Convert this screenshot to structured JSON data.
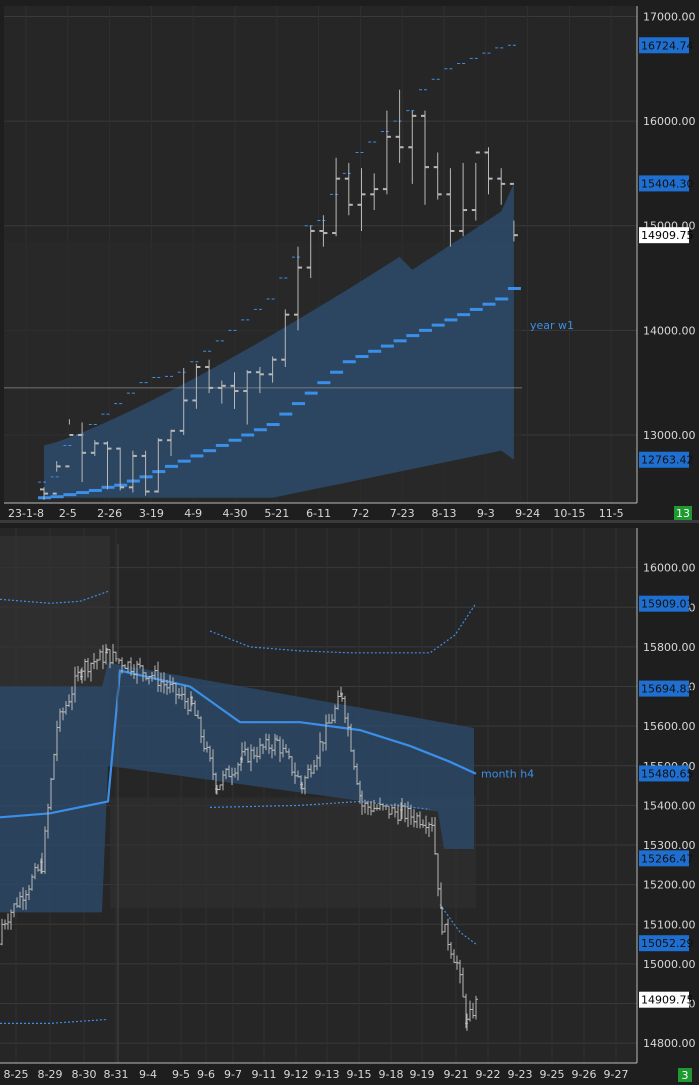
{
  "colors": {
    "background": "#262626",
    "grid": "#3a3a3a",
    "axis_text": "#d8d8d8",
    "candle": "#b8b8b8",
    "band": "#2d4a6a",
    "accent_blue": "#3b8fe8",
    "label_bg": "#1f6fd0",
    "counter_green": "#1f9a30",
    "price_tag_bg": "#ffffff"
  },
  "chart_data": [
    {
      "type": "candlestick",
      "title": "",
      "ylim": [
        12350,
        17100
      ],
      "y_ticks": [
        "17000.00",
        "16000.00",
        "15000.00",
        "14000.00",
        "13000.00"
      ],
      "x_tick_labels": [
        "23-1-8",
        "2-5",
        "2-26",
        "3-19",
        "4-9",
        "4-30",
        "5-21",
        "6-11",
        "7-2",
        "7-23",
        "8-13",
        "9-3",
        "9-24",
        "10-15",
        "11-5"
      ],
      "price_tags": [
        {
          "text": "16724.74",
          "value": 16724.74,
          "style": "blue"
        },
        {
          "text": "15404.30",
          "value": 15404.3,
          "style": "blue"
        },
        {
          "text": "14909.75",
          "value": 14909.75,
          "style": "white"
        },
        {
          "text": "12763.42",
          "value": 12763.42,
          "style": "blue"
        }
      ],
      "series_label": "year w1",
      "corner_badge": "13",
      "candles": [
        [
          12480,
          12500,
          12380,
          12440
        ],
        [
          12440,
          12750,
          12650,
          12700
        ],
        [
          12700,
          13150,
          13100,
          13000
        ],
        [
          13000,
          13120,
          12550,
          12830
        ],
        [
          12830,
          12950,
          12800,
          12920
        ],
        [
          12920,
          12940,
          12480,
          12870
        ],
        [
          12870,
          12880,
          12470,
          12500
        ],
        [
          12500,
          12850,
          12450,
          12800
        ],
        [
          12800,
          12850,
          12420,
          12460
        ],
        [
          12460,
          12970,
          12450,
          12950
        ],
        [
          12950,
          13050,
          12800,
          13040
        ],
        [
          13040,
          13640,
          13000,
          13330
        ],
        [
          13330,
          13680,
          13250,
          13650
        ],
        [
          13650,
          13720,
          13400,
          13450
        ],
        [
          13450,
          13520,
          13300,
          13470
        ],
        [
          13470,
          13600,
          13250,
          13420
        ],
        [
          13420,
          13620,
          13100,
          13600
        ],
        [
          13600,
          13650,
          13400,
          13580
        ],
        [
          13580,
          13750,
          13500,
          13720
        ],
        [
          13720,
          14200,
          13650,
          14150
        ],
        [
          14150,
          14800,
          14000,
          14600
        ],
        [
          14600,
          15000,
          14500,
          14950
        ],
        [
          14950,
          15100,
          14800,
          14930
        ],
        [
          14930,
          15650,
          14900,
          15450
        ],
        [
          15450,
          15600,
          15100,
          15200
        ],
        [
          15200,
          15550,
          14950,
          15300
        ],
        [
          15300,
          15500,
          15150,
          15350
        ],
        [
          15350,
          16100,
          15300,
          15850
        ],
        [
          15850,
          16300,
          15600,
          15750
        ],
        [
          15750,
          16100,
          15400,
          16050
        ],
        [
          16050,
          16100,
          15200,
          15560
        ],
        [
          15560,
          15700,
          15250,
          15300
        ],
        [
          15300,
          15550,
          14800,
          14950
        ],
        [
          14950,
          15600,
          14900,
          15150
        ],
        [
          15150,
          15600,
          15050,
          15700
        ],
        [
          15700,
          15750,
          15300,
          15450
        ],
        [
          15450,
          15550,
          15200,
          15400
        ],
        [
          15400,
          15050,
          14850,
          14909.75
        ]
      ],
      "upper_dashes": [
        12550,
        12600,
        12900,
        13000,
        13100,
        13200,
        13300,
        13400,
        13500,
        13550,
        13560,
        13600,
        13700,
        13800,
        13900,
        14000,
        14100,
        14200,
        14300,
        14500,
        14700,
        15000,
        15050,
        15300,
        15500,
        15700,
        15800,
        15900,
        16000,
        16100,
        16300,
        16400,
        16500,
        16550,
        16600,
        16650,
        16700,
        16724.74
      ],
      "year_line": [
        12400,
        12410,
        12430,
        12450,
        12470,
        12500,
        12520,
        12560,
        12600,
        12650,
        12700,
        12750,
        12800,
        12850,
        12900,
        12950,
        13000,
        13050,
        13100,
        13200,
        13300,
        13400,
        13500,
        13600,
        13700,
        13750,
        13800,
        13850,
        13900,
        13950,
        14000,
        14050,
        14100,
        14150,
        14200,
        14250,
        14300,
        14400
      ]
    },
    {
      "type": "candlestick",
      "title": "",
      "ylim": [
        14750,
        16100
      ],
      "y_ticks": [
        "16000.00",
        "15900.00",
        "15800.00",
        "15700.00",
        "15600.00",
        "15500.00",
        "15400.00",
        "15300.00",
        "15200.00",
        "15100.00",
        "15000.00",
        "14900.00",
        "14800.00"
      ],
      "x_tick_labels": [
        "8-25",
        "8-29",
        "8-30",
        "8-31",
        "9-4",
        "9-5",
        "9-6",
        "9-7",
        "9-11",
        "9-12",
        "9-13",
        "9-15",
        "9-18",
        "9-19",
        "9-21",
        "9-22",
        "9-23",
        "9-25",
        "9-26",
        "9-27"
      ],
      "price_tags": [
        {
          "text": "15909.01",
          "value": 15909.01,
          "style": "blue"
        },
        {
          "text": "15694.83",
          "value": 15694.83,
          "style": "blue"
        },
        {
          "text": "15480.65",
          "value": 15480.65,
          "style": "blue"
        },
        {
          "text": "15266.47",
          "value": 15266.47,
          "style": "blue"
        },
        {
          "text": "15052.29",
          "value": 15052.29,
          "style": "blue"
        },
        {
          "text": "14909.75",
          "value": 14909.75,
          "style": "white"
        }
      ],
      "series_label": "month h4",
      "corner_badge": "3"
    }
  ]
}
